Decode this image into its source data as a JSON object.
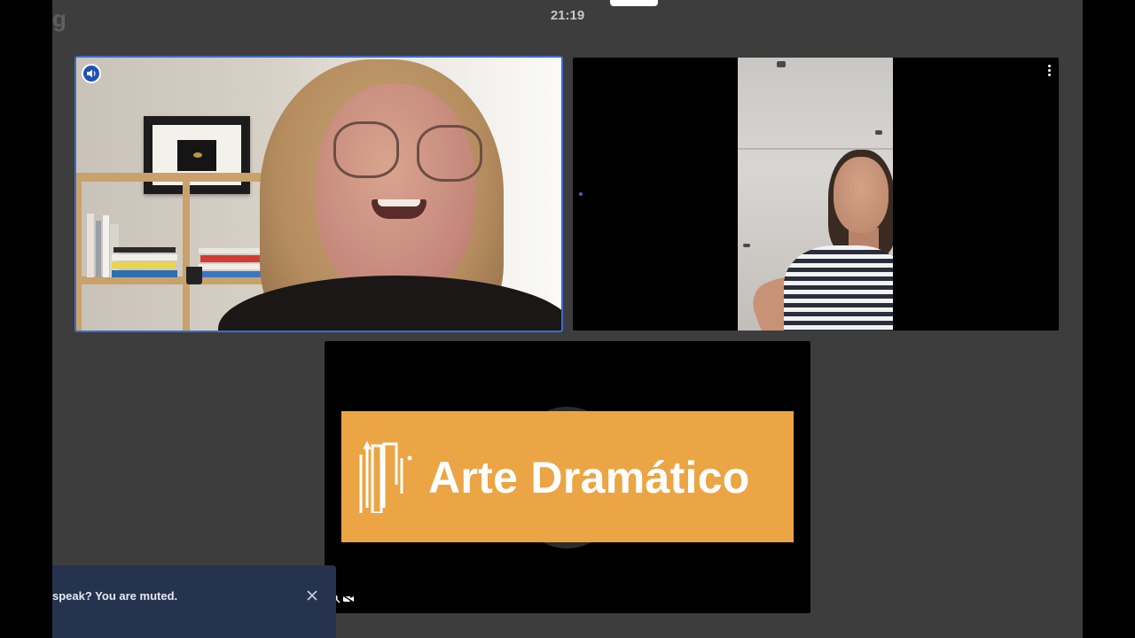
{
  "status_bar": {
    "time": "21:19",
    "app_initial": "g"
  },
  "participants": [
    {
      "tile": "participant-1",
      "active_speaker": true
    },
    {
      "tile": "participant-2",
      "active_speaker": false
    },
    {
      "tile": "participant-3-presentation",
      "active_speaker": false
    }
  ],
  "presentation": {
    "brand_text": "Arte Dramático",
    "brand_color": "#eba545"
  },
  "toast": {
    "message": "speak? You are muted.",
    "close_icon": "close-icon"
  },
  "colors": {
    "background": "#3d3d3d",
    "active_speaker_border": "#3e6cc9",
    "toast_background": "#26334f"
  }
}
